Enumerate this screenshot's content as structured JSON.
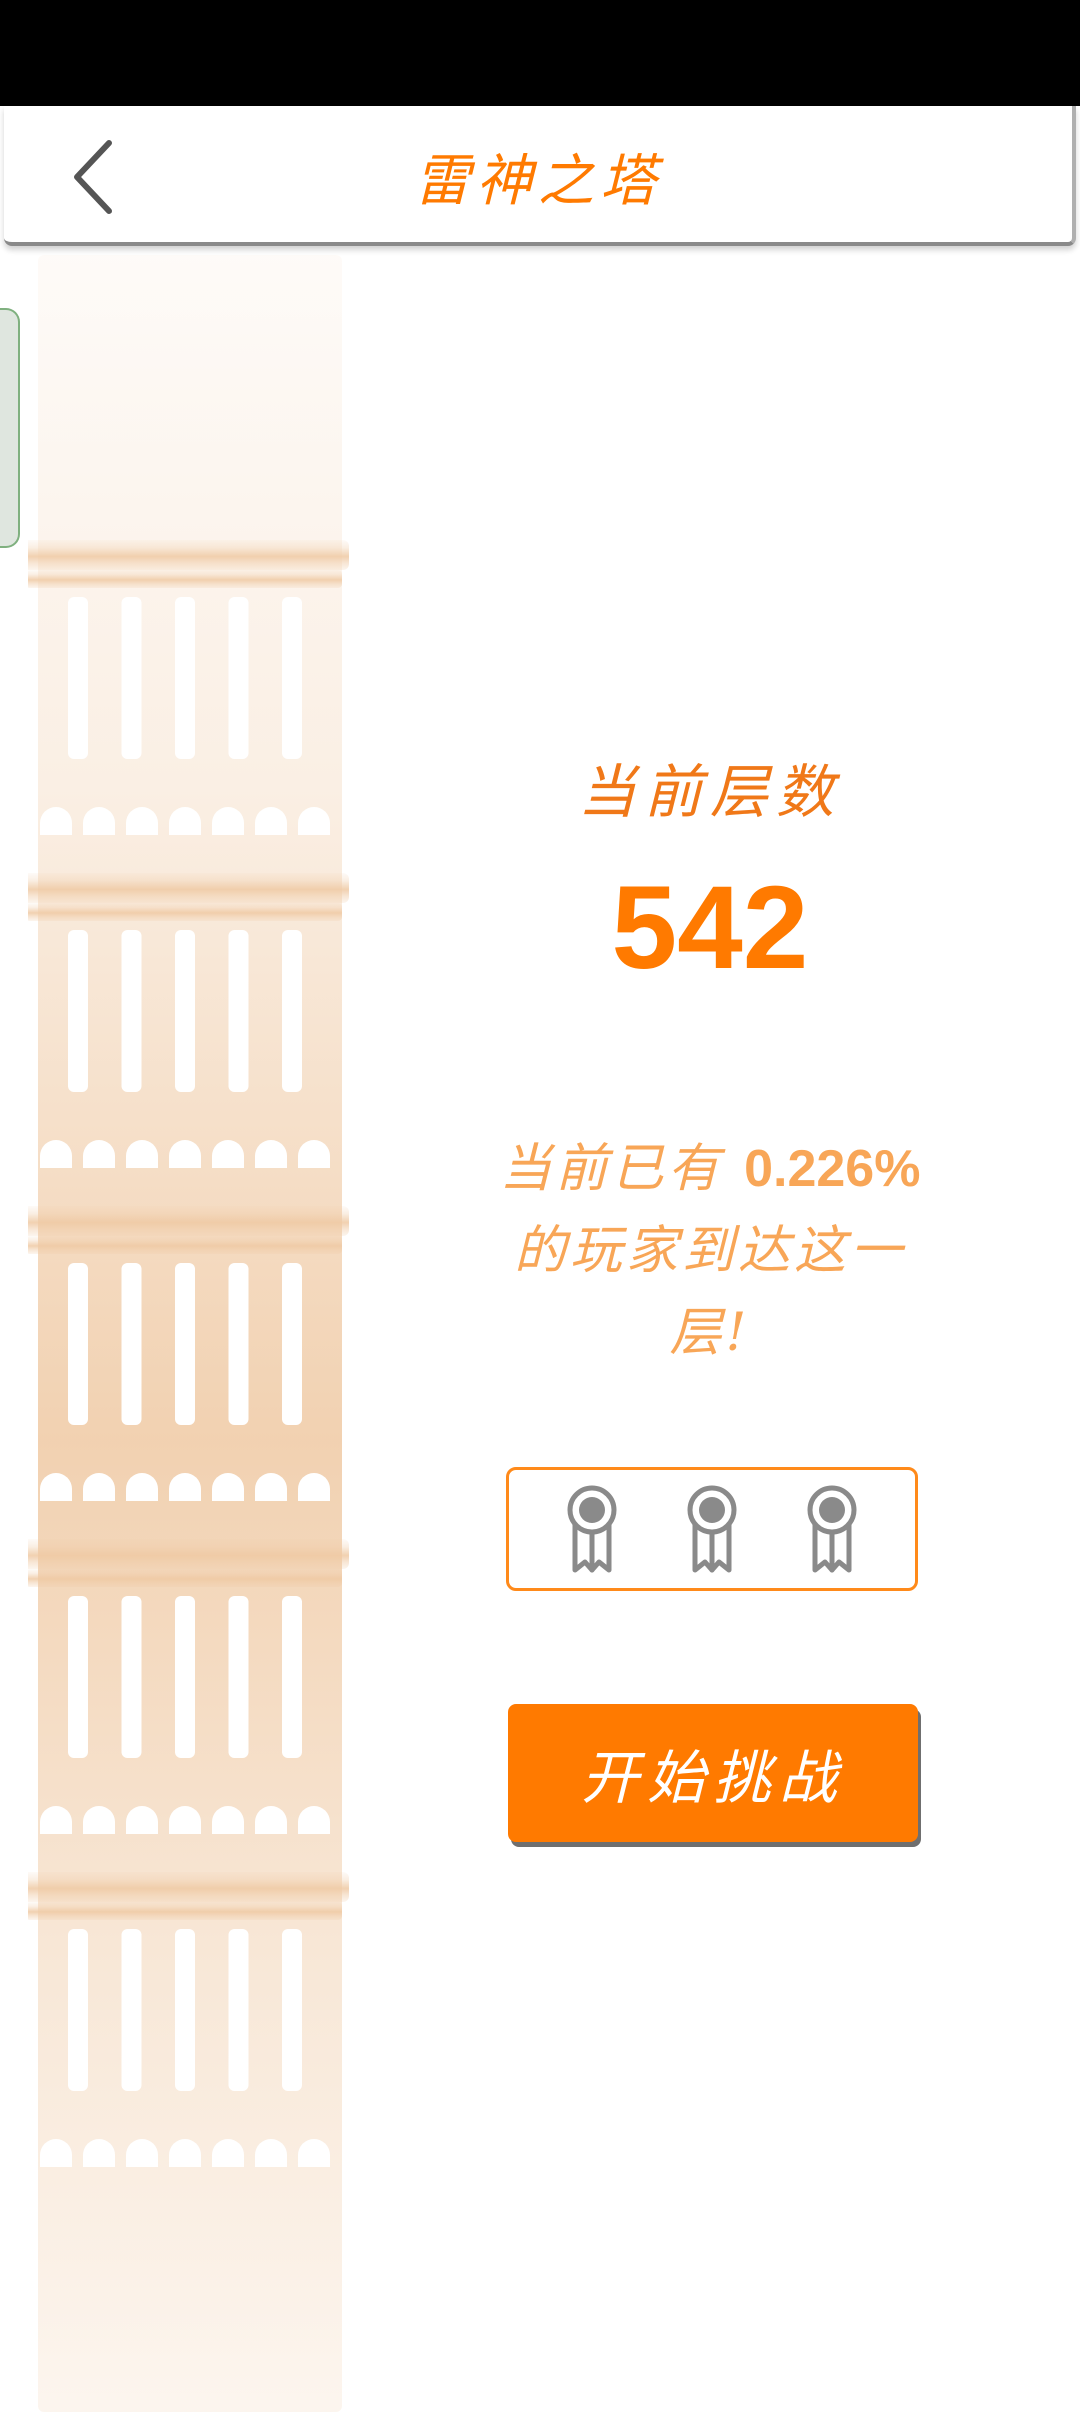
{
  "header": {
    "title": "雷神之塔",
    "back_icon": "chevron-left-icon"
  },
  "floor": {
    "label": "当前层数",
    "number": "542"
  },
  "stats": {
    "prefix": "当前已有 ",
    "percent": "0.226%",
    "suffix": "的玩家到达这一层!"
  },
  "medals": {
    "icons": [
      "medal-icon",
      "medal-icon",
      "medal-icon"
    ]
  },
  "actions": {
    "start_label": "开始挑战"
  },
  "colors": {
    "accent": "#ff7a00",
    "stat_text": "#f8a657",
    "tower": "#efc9a3",
    "medal": "#8a8a8a"
  }
}
